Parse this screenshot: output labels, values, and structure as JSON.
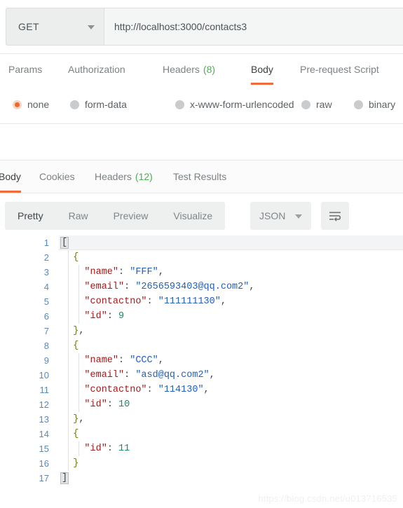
{
  "request": {
    "method": "GET",
    "url": "http://localhost:3000/contacts3",
    "tabs": [
      {
        "label": "Params",
        "count": "",
        "active": false
      },
      {
        "label": "Authorization",
        "count": "",
        "active": false
      },
      {
        "label": "Headers",
        "count": "(8)",
        "active": false
      },
      {
        "label": "Body",
        "count": "",
        "active": true
      },
      {
        "label": "Pre-request Script",
        "count": "",
        "active": false
      }
    ],
    "body_types": [
      {
        "label": "none",
        "selected": true
      },
      {
        "label": "form-data",
        "selected": false
      },
      {
        "label": "x-www-form-urlencoded",
        "selected": false
      },
      {
        "label": "raw",
        "selected": false
      },
      {
        "label": "binary",
        "selected": false
      }
    ]
  },
  "response": {
    "tabs": [
      {
        "label": "Body",
        "count": "",
        "active": true
      },
      {
        "label": "Cookies",
        "count": "",
        "active": false
      },
      {
        "label": "Headers",
        "count": "(12)",
        "active": false
      },
      {
        "label": "Test Results",
        "count": "",
        "active": false
      }
    ],
    "view_modes": [
      {
        "label": "Pretty",
        "active": true
      },
      {
        "label": "Raw",
        "active": false
      },
      {
        "label": "Preview",
        "active": false
      },
      {
        "label": "Visualize",
        "active": false
      }
    ],
    "format": "JSON",
    "wrap_icon": "word-wrap-icon"
  },
  "code": {
    "language": "json",
    "line_count": 17,
    "lines": [
      {
        "num": "1",
        "tokens": [
          {
            "t": "[",
            "c": "brk-box"
          }
        ]
      },
      {
        "num": "2",
        "tokens": [
          {
            "t": "  ",
            "c": "p"
          },
          {
            "t": "{",
            "c": "b"
          }
        ]
      },
      {
        "num": "3",
        "tokens": [
          {
            "t": "    ",
            "c": "p"
          },
          {
            "t": "\"name\"",
            "c": "k"
          },
          {
            "t": ": ",
            "c": "p"
          },
          {
            "t": "\"FFF\"",
            "c": "s"
          },
          {
            "t": ",",
            "c": "p"
          }
        ]
      },
      {
        "num": "4",
        "tokens": [
          {
            "t": "    ",
            "c": "p"
          },
          {
            "t": "\"email\"",
            "c": "k"
          },
          {
            "t": ": ",
            "c": "p"
          },
          {
            "t": "\"2656593403@qq.com2\"",
            "c": "s"
          },
          {
            "t": ",",
            "c": "p"
          }
        ]
      },
      {
        "num": "5",
        "tokens": [
          {
            "t": "    ",
            "c": "p"
          },
          {
            "t": "\"contactno\"",
            "c": "k"
          },
          {
            "t": ": ",
            "c": "p"
          },
          {
            "t": "\"111111130\"",
            "c": "s"
          },
          {
            "t": ",",
            "c": "p"
          }
        ]
      },
      {
        "num": "6",
        "tokens": [
          {
            "t": "    ",
            "c": "p"
          },
          {
            "t": "\"id\"",
            "c": "k"
          },
          {
            "t": ": ",
            "c": "p"
          },
          {
            "t": "9",
            "c": "n"
          }
        ]
      },
      {
        "num": "7",
        "tokens": [
          {
            "t": "  ",
            "c": "p"
          },
          {
            "t": "}",
            "c": "b"
          },
          {
            "t": ",",
            "c": "p"
          }
        ]
      },
      {
        "num": "8",
        "tokens": [
          {
            "t": "  ",
            "c": "p"
          },
          {
            "t": "{",
            "c": "b"
          }
        ]
      },
      {
        "num": "9",
        "tokens": [
          {
            "t": "    ",
            "c": "p"
          },
          {
            "t": "\"name\"",
            "c": "k"
          },
          {
            "t": ": ",
            "c": "p"
          },
          {
            "t": "\"CCC\"",
            "c": "s"
          },
          {
            "t": ",",
            "c": "p"
          }
        ]
      },
      {
        "num": "10",
        "tokens": [
          {
            "t": "    ",
            "c": "p"
          },
          {
            "t": "\"email\"",
            "c": "k"
          },
          {
            "t": ": ",
            "c": "p"
          },
          {
            "t": "\"asd@qq.com2\"",
            "c": "s"
          },
          {
            "t": ",",
            "c": "p"
          }
        ]
      },
      {
        "num": "11",
        "tokens": [
          {
            "t": "    ",
            "c": "p"
          },
          {
            "t": "\"contactno\"",
            "c": "k"
          },
          {
            "t": ": ",
            "c": "p"
          },
          {
            "t": "\"114130\"",
            "c": "s"
          },
          {
            "t": ",",
            "c": "p"
          }
        ]
      },
      {
        "num": "12",
        "tokens": [
          {
            "t": "    ",
            "c": "p"
          },
          {
            "t": "\"id\"",
            "c": "k"
          },
          {
            "t": ": ",
            "c": "p"
          },
          {
            "t": "10",
            "c": "n"
          }
        ]
      },
      {
        "num": "13",
        "tokens": [
          {
            "t": "  ",
            "c": "p"
          },
          {
            "t": "}",
            "c": "b"
          },
          {
            "t": ",",
            "c": "p"
          }
        ]
      },
      {
        "num": "14",
        "tokens": [
          {
            "t": "  ",
            "c": "p"
          },
          {
            "t": "{",
            "c": "b"
          }
        ]
      },
      {
        "num": "15",
        "tokens": [
          {
            "t": "    ",
            "c": "p"
          },
          {
            "t": "\"id\"",
            "c": "k"
          },
          {
            "t": ": ",
            "c": "p"
          },
          {
            "t": "11",
            "c": "n"
          }
        ]
      },
      {
        "num": "16",
        "tokens": [
          {
            "t": "  ",
            "c": "p"
          },
          {
            "t": "}",
            "c": "b"
          }
        ]
      },
      {
        "num": "17",
        "tokens": [
          {
            "t": "]",
            "c": "brk-box"
          }
        ]
      }
    ]
  },
  "watermark": "https://blog.csdn.net/u013716535",
  "colors": {
    "accent": "#f26b3a",
    "count_green": "#4caf50",
    "json_key": "#a21b1b",
    "json_string": "#1f5fbe",
    "json_number": "#1a8a5a",
    "json_brace": "#6e7a12",
    "line_number": "#5a89b8"
  }
}
